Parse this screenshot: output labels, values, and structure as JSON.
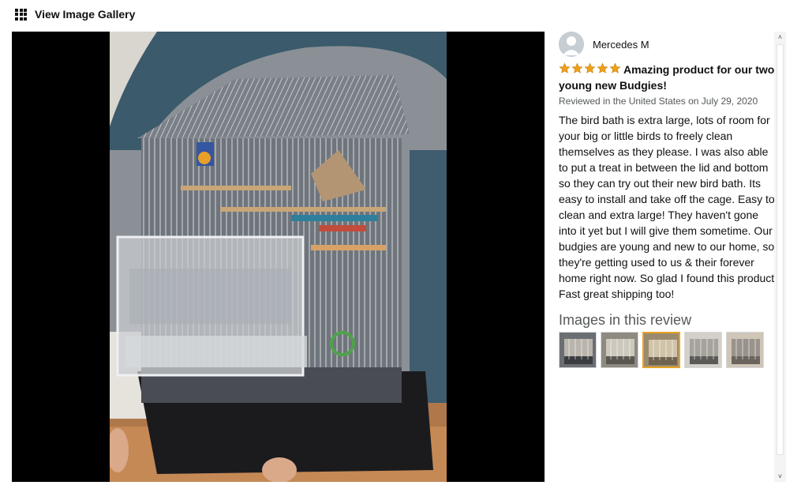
{
  "header": {
    "title": "View Image Gallery",
    "icon": "grid-icon"
  },
  "viewer": {
    "image_description_icon": "photo"
  },
  "review": {
    "reviewer_name": "Mercedes M",
    "rating": 5,
    "rating_max": 5,
    "star_color": "#f0a11a",
    "title": "Amazing product for our two young new Budgies!",
    "meta": "Reviewed in the United States on July 29, 2020",
    "body": "The bird bath is extra large, lots of room for your big or little birds to freely clean themselves as they please. I was also able to put a treat in between the lid and bottom so they can try out their new bird bath. Its easy to install and take off the cage. Easy to clean and extra large! They haven't gone into it yet but I will give them sometime. Our budgies are young and new to our home, so they're getting used to us & their forever home right now. So glad I found this product! Fast great shipping too!",
    "images_heading": "Images in this review",
    "thumbnails": [
      {
        "selected": false
      },
      {
        "selected": false
      },
      {
        "selected": true
      },
      {
        "selected": false
      },
      {
        "selected": false
      }
    ],
    "selected_border_color": "#e7a325"
  },
  "scrollbar": {
    "up_glyph": "˄",
    "down_glyph": "˅"
  }
}
